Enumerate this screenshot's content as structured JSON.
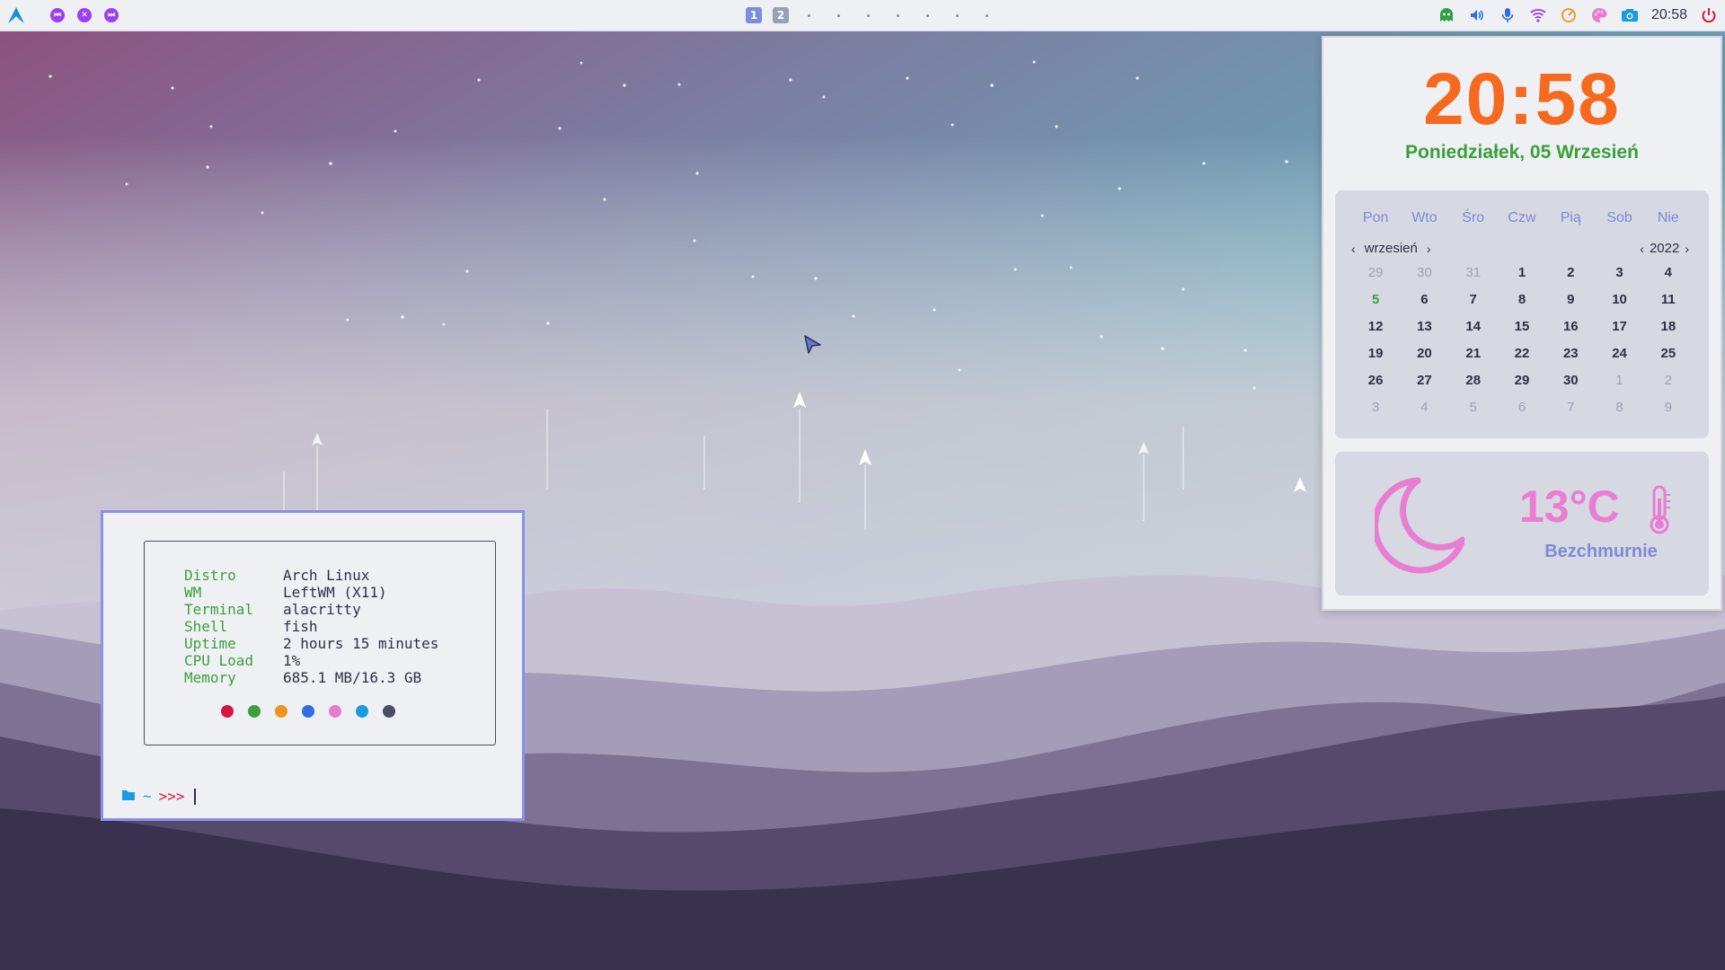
{
  "topbar": {
    "logo_icon": "arch-linux-logo",
    "media": [
      {
        "name": "previous-track-icon",
        "glyph": "⏮"
      },
      {
        "name": "stop-icon",
        "glyph": "✕"
      },
      {
        "name": "next-track-icon",
        "glyph": "⏭"
      }
    ],
    "workspaces": [
      "1",
      "2"
    ],
    "active_workspace": "1",
    "tray_icons": [
      "ghost-icon",
      "volume-icon",
      "microphone-icon",
      "wifi-icon",
      "speedometer-icon",
      "palette-icon",
      "camera-icon",
      "power-icon"
    ],
    "clock": "20:58"
  },
  "widget": {
    "time": "20:58",
    "date": "Poniedziałek, 05 Wrzesień",
    "calendar": {
      "weekdays": [
        "Pon",
        "Wto",
        "Śro",
        "Czw",
        "Pią",
        "Sob",
        "Nie"
      ],
      "month": "wrzesień",
      "year": "2022",
      "days": [
        [
          "29",
          "30",
          "31",
          "1",
          "2",
          "3",
          "4"
        ],
        [
          "5",
          "6",
          "7",
          "8",
          "9",
          "10",
          "11"
        ],
        [
          "12",
          "13",
          "14",
          "15",
          "16",
          "17",
          "18"
        ],
        [
          "19",
          "20",
          "21",
          "22",
          "23",
          "24",
          "25"
        ],
        [
          "26",
          "27",
          "28",
          "29",
          "30",
          "1",
          "2"
        ],
        [
          "3",
          "4",
          "5",
          "6",
          "7",
          "8",
          "9"
        ]
      ],
      "today": "5"
    },
    "weather": {
      "temperature": "13°C",
      "description": "Bezchmurnie",
      "icon": "moon-icon"
    }
  },
  "terminal": {
    "fetch": [
      {
        "key": "Distro",
        "value": "Arch Linux"
      },
      {
        "key": "WM",
        "value": "LeftWM (X11)"
      },
      {
        "key": "Terminal",
        "value": "alacritty"
      },
      {
        "key": "Shell",
        "value": "fish"
      },
      {
        "key": "Uptime",
        "value": "2 hours 15 minutes"
      },
      {
        "key": "CPU Load",
        "value": "1%"
      },
      {
        "key": "Memory",
        "value": "685.1 MB/16.3 GB"
      }
    ],
    "colors": [
      "#d3173d",
      "#3aa03a",
      "#e99520",
      "#2f6fe0",
      "#e87ad2",
      "#1a9be0",
      "#4a4c6a"
    ],
    "prompt": {
      "dir": "~",
      "arrows": ">>>"
    }
  },
  "colors": {
    "accent_orange": "#f56a1f",
    "accent_green": "#3aa03a",
    "accent_blue": "#7e8ad8",
    "accent_pink": "#e97dd2",
    "terminal_border": "#8a91e6"
  }
}
